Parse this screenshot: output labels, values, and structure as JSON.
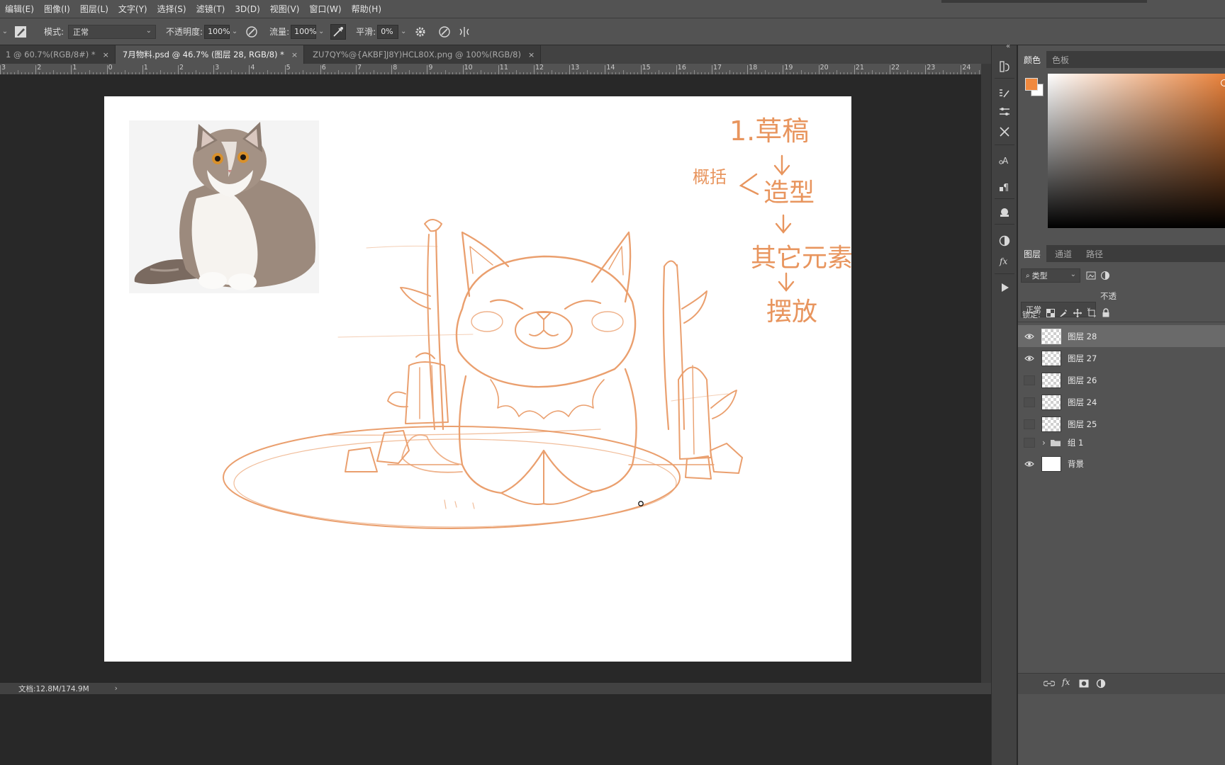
{
  "menu": [
    "编辑(E)",
    "图像(I)",
    "图层(L)",
    "文字(Y)",
    "选择(S)",
    "滤镜(T)",
    "3D(D)",
    "视图(V)",
    "窗口(W)",
    "帮助(H)"
  ],
  "options": {
    "mode_label": "模式:",
    "mode_value": "正常",
    "opacity_label": "不透明度:",
    "opacity_value": "100%",
    "flow_label": "流量:",
    "flow_value": "100%",
    "smooth_label": "平滑:",
    "smooth_value": "0%"
  },
  "tabs": [
    {
      "label": "1 @ 60.7%(RGB/8#) *",
      "active": false
    },
    {
      "label": "7月物料.psd @ 46.7% (图层 28, RGB/8) *",
      "active": true
    },
    {
      "label": "ZU7QY%@{AKBF]J8Y)HCL80X.png @ 100%(RGB/8)",
      "active": false
    }
  ],
  "ruler_ticks": [
    "3",
    "2",
    "1",
    "0",
    "1",
    "2",
    "3",
    "4",
    "5",
    "6",
    "7",
    "8",
    "9",
    "10",
    "11",
    "12",
    "13",
    "14",
    "15",
    "16",
    "17",
    "18",
    "19",
    "20",
    "21",
    "22",
    "23",
    "24"
  ],
  "status": {
    "doc": "文档:12.8M/174.9M",
    "arrow": "›"
  },
  "color_panel": {
    "tabs": [
      "颜色",
      "色板"
    ],
    "foreground": "#F0893E",
    "background": "#FFFFFF"
  },
  "layers_panel": {
    "tabs": [
      "图层",
      "通道",
      "路径"
    ],
    "filter_label": "类型",
    "blend_mode": "正常",
    "opacity_label": "不透",
    "lock_label": "锁定:",
    "layers": [
      {
        "name": "图层 28",
        "visible": true,
        "selected": true,
        "thumb": "checker"
      },
      {
        "name": "图层 27",
        "visible": true,
        "selected": false,
        "thumb": "checker"
      },
      {
        "name": "图层 26",
        "visible": false,
        "selected": false,
        "thumb": "checker"
      },
      {
        "name": "图层 24",
        "visible": false,
        "selected": false,
        "thumb": "checker"
      },
      {
        "name": "图层 25",
        "visible": false,
        "selected": false,
        "thumb": "checker"
      },
      {
        "name": "组 1",
        "visible": false,
        "selected": false,
        "thumb": "folder"
      },
      {
        "name": "背景",
        "visible": true,
        "selected": false,
        "thumb": "white"
      }
    ]
  },
  "canvas": {
    "sketch_color": "#E8955E",
    "notes": [
      "1.草稿",
      "造型",
      "其它元素",
      "摆放",
      "概括"
    ]
  }
}
